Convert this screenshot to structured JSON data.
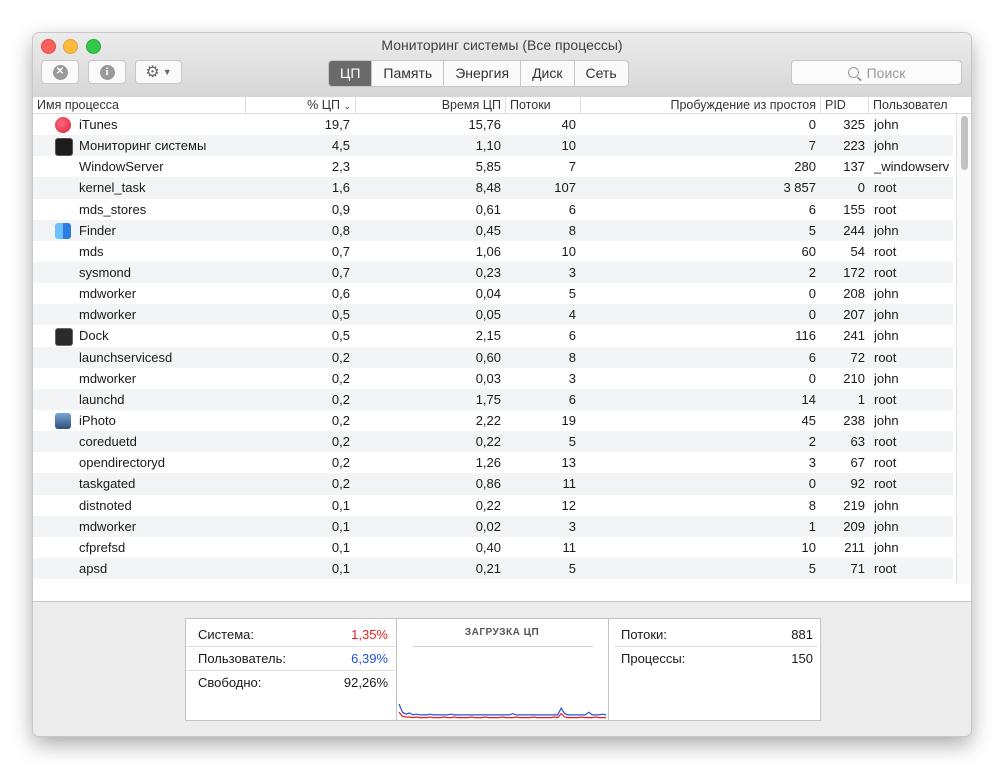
{
  "window": {
    "title": "Мониторинг системы (Все процессы)"
  },
  "toolbar": {
    "tabs": [
      "ЦП",
      "Память",
      "Энергия",
      "Диск",
      "Сеть"
    ],
    "active_tab": "ЦП",
    "search_placeholder": "Поиск",
    "stop_icon": "x-circle-icon",
    "info_icon": "info-icon",
    "gear_icon": "gear-icon"
  },
  "table": {
    "columns": [
      "Имя процесса",
      "% ЦП",
      "Время ЦП",
      "Потоки",
      "Пробуждение из простоя",
      "PID",
      "Пользовател"
    ],
    "sort_column": "% ЦП",
    "rows": [
      {
        "name": "iTunes",
        "cpu": "19,7",
        "time": "15,76",
        "threads": "40",
        "wakeups": "0",
        "pid": "325",
        "user": "john",
        "icon": "itunes-icon"
      },
      {
        "name": "Мониторинг системы",
        "cpu": "4,5",
        "time": "1,10",
        "threads": "10",
        "wakeups": "7",
        "pid": "223",
        "user": "john",
        "icon": "activity-monitor-icon"
      },
      {
        "name": "WindowServer",
        "cpu": "2,3",
        "time": "5,85",
        "threads": "7",
        "wakeups": "280",
        "pid": "137",
        "user": "_windowserv",
        "icon": ""
      },
      {
        "name": "kernel_task",
        "cpu": "1,6",
        "time": "8,48",
        "threads": "107",
        "wakeups": "3 857",
        "pid": "0",
        "user": "root",
        "icon": ""
      },
      {
        "name": "mds_stores",
        "cpu": "0,9",
        "time": "0,61",
        "threads": "6",
        "wakeups": "6",
        "pid": "155",
        "user": "root",
        "icon": ""
      },
      {
        "name": "Finder",
        "cpu": "0,8",
        "time": "0,45",
        "threads": "8",
        "wakeups": "5",
        "pid": "244",
        "user": "john",
        "icon": "finder-icon"
      },
      {
        "name": "mds",
        "cpu": "0,7",
        "time": "1,06",
        "threads": "10",
        "wakeups": "60",
        "pid": "54",
        "user": "root",
        "icon": ""
      },
      {
        "name": "sysmond",
        "cpu": "0,7",
        "time": "0,23",
        "threads": "3",
        "wakeups": "2",
        "pid": "172",
        "user": "root",
        "icon": ""
      },
      {
        "name": "mdworker",
        "cpu": "0,6",
        "time": "0,04",
        "threads": "5",
        "wakeups": "0",
        "pid": "208",
        "user": "john",
        "icon": ""
      },
      {
        "name": "mdworker",
        "cpu": "0,5",
        "time": "0,05",
        "threads": "4",
        "wakeups": "0",
        "pid": "207",
        "user": "john",
        "icon": ""
      },
      {
        "name": "Dock",
        "cpu": "0,5",
        "time": "2,15",
        "threads": "6",
        "wakeups": "116",
        "pid": "241",
        "user": "john",
        "icon": "dock-icon"
      },
      {
        "name": "launchservicesd",
        "cpu": "0,2",
        "time": "0,60",
        "threads": "8",
        "wakeups": "6",
        "pid": "72",
        "user": "root",
        "icon": ""
      },
      {
        "name": "mdworker",
        "cpu": "0,2",
        "time": "0,03",
        "threads": "3",
        "wakeups": "0",
        "pid": "210",
        "user": "john",
        "icon": ""
      },
      {
        "name": "launchd",
        "cpu": "0,2",
        "time": "1,75",
        "threads": "6",
        "wakeups": "14",
        "pid": "1",
        "user": "root",
        "icon": ""
      },
      {
        "name": "iPhoto",
        "cpu": "0,2",
        "time": "2,22",
        "threads": "19",
        "wakeups": "45",
        "pid": "238",
        "user": "john",
        "icon": "iphoto-icon"
      },
      {
        "name": "coreduetd",
        "cpu": "0,2",
        "time": "0,22",
        "threads": "5",
        "wakeups": "2",
        "pid": "63",
        "user": "root",
        "icon": ""
      },
      {
        "name": "opendirectoryd",
        "cpu": "0,2",
        "time": "1,26",
        "threads": "13",
        "wakeups": "3",
        "pid": "67",
        "user": "root",
        "icon": ""
      },
      {
        "name": "taskgated",
        "cpu": "0,2",
        "time": "0,86",
        "threads": "11",
        "wakeups": "0",
        "pid": "92",
        "user": "root",
        "icon": ""
      },
      {
        "name": "distnoted",
        "cpu": "0,1",
        "time": "0,22",
        "threads": "12",
        "wakeups": "8",
        "pid": "219",
        "user": "john",
        "icon": ""
      },
      {
        "name": "mdworker",
        "cpu": "0,1",
        "time": "0,02",
        "threads": "3",
        "wakeups": "1",
        "pid": "209",
        "user": "john",
        "icon": ""
      },
      {
        "name": "cfprefsd",
        "cpu": "0,1",
        "time": "0,40",
        "threads": "11",
        "wakeups": "10",
        "pid": "211",
        "user": "john",
        "icon": ""
      },
      {
        "name": "apsd",
        "cpu": "0,1",
        "time": "0,21",
        "threads": "5",
        "wakeups": "5",
        "pid": "71",
        "user": "root",
        "icon": ""
      }
    ]
  },
  "summary": {
    "left": [
      {
        "label": "Система:",
        "value": "1,35%",
        "color": "#e02020"
      },
      {
        "label": "Пользователь:",
        "value": "6,39%",
        "color": "#1f4fd6"
      },
      {
        "label": "Свободно:",
        "value": "92,26%",
        "color": "#1a1a1a"
      }
    ],
    "graph_title": "ЗАГРУЗКА ЦП",
    "graph": {
      "system_color": "#e02020",
      "user_color": "#2a4fd8",
      "system": [
        0.1,
        0.04,
        0.03,
        0.03,
        0.02,
        0.03,
        0.02,
        0.02,
        0.02,
        0.03,
        0.02,
        0.02,
        0.02,
        0.03,
        0.02,
        0.02,
        0.03,
        0.02,
        0.02,
        0.02,
        0.02,
        0.03,
        0.02,
        0.02,
        0.02,
        0.03,
        0.02,
        0.02,
        0.02,
        0.02,
        0.03,
        0.02,
        0.02,
        0.02,
        0.03,
        0.02,
        0.02,
        0.02,
        0.02,
        0.03,
        0.02,
        0.02,
        0.02,
        0.02,
        0.02,
        0.03,
        0.02,
        0.08,
        0.03,
        0.02,
        0.02,
        0.02,
        0.02,
        0.03,
        0.02,
        0.02,
        0.02,
        0.03,
        0.02,
        0.02,
        0.02
      ],
      "user": [
        0.22,
        0.1,
        0.07,
        0.09,
        0.06,
        0.07,
        0.06,
        0.06,
        0.06,
        0.07,
        0.06,
        0.06,
        0.06,
        0.06,
        0.06,
        0.07,
        0.06,
        0.06,
        0.06,
        0.06,
        0.06,
        0.06,
        0.06,
        0.06,
        0.06,
        0.06,
        0.06,
        0.06,
        0.06,
        0.06,
        0.06,
        0.06,
        0.06,
        0.08,
        0.06,
        0.06,
        0.06,
        0.06,
        0.06,
        0.06,
        0.06,
        0.06,
        0.06,
        0.06,
        0.06,
        0.06,
        0.06,
        0.16,
        0.08,
        0.06,
        0.06,
        0.06,
        0.06,
        0.06,
        0.06,
        0.1,
        0.06,
        0.06,
        0.06,
        0.07,
        0.06
      ]
    },
    "right": [
      {
        "label": "Потоки:",
        "value": "881"
      },
      {
        "label": "Процессы:",
        "value": "150"
      }
    ]
  }
}
